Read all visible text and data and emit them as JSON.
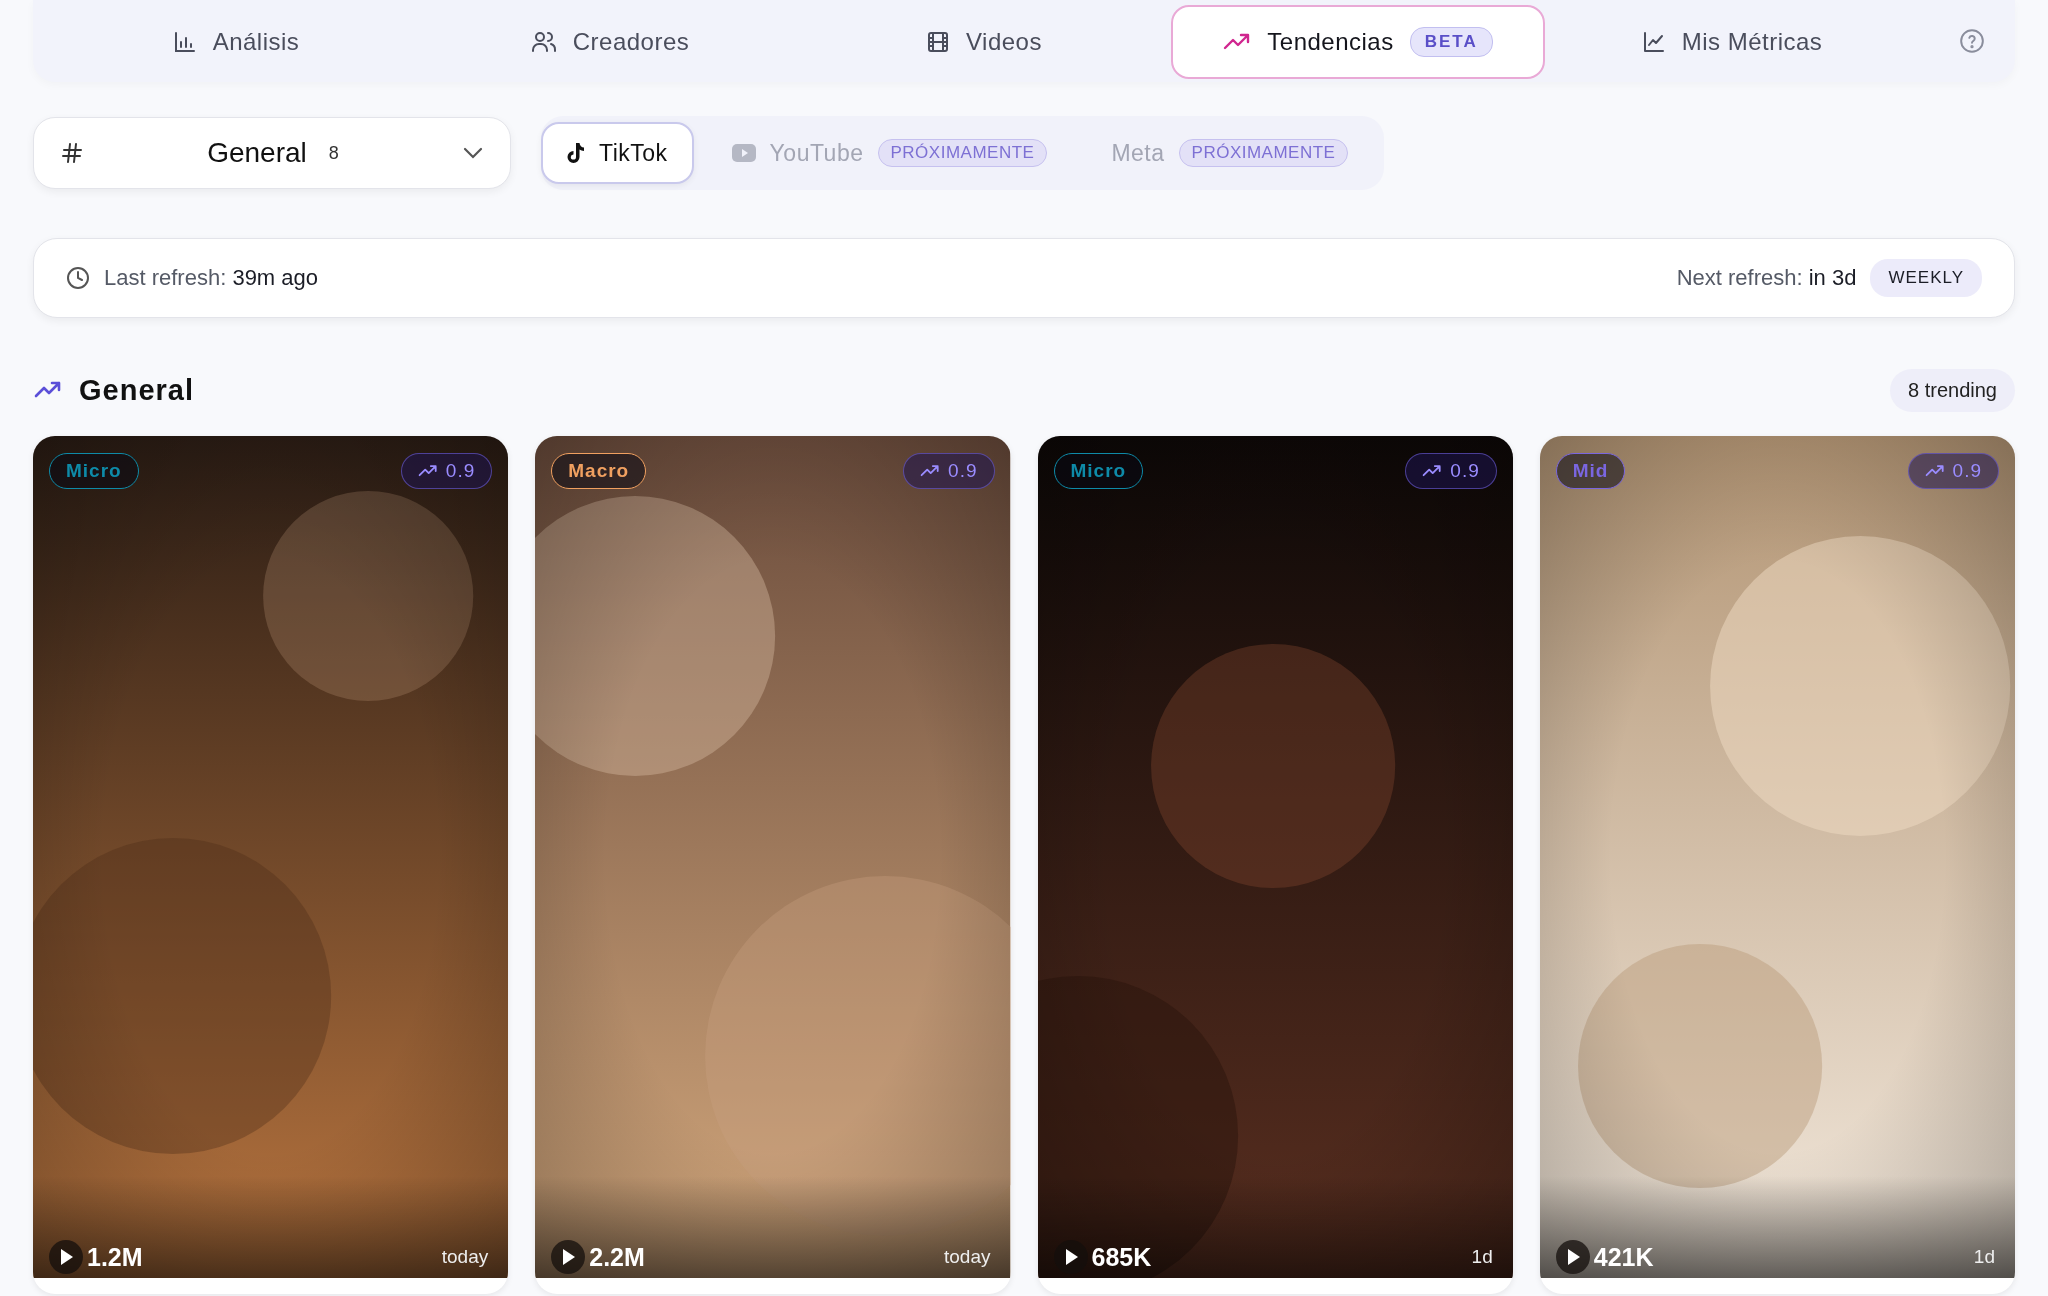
{
  "nav": {
    "tabs": [
      {
        "label": "Análisis",
        "selected": false
      },
      {
        "label": "Creadores",
        "selected": false
      },
      {
        "label": "Videos",
        "selected": false
      },
      {
        "label": "Tendencias",
        "selected": true,
        "badge": "BETA"
      },
      {
        "label": "Mis Métricas",
        "selected": false
      }
    ]
  },
  "category": {
    "value": "General",
    "count": "8"
  },
  "platforms": [
    {
      "label": "TikTok",
      "selected": true,
      "disabled": false
    },
    {
      "label": "YouTube",
      "selected": false,
      "disabled": true,
      "badge": "PRÓXIMAMENTE"
    },
    {
      "label": "Meta",
      "selected": false,
      "disabled": true,
      "badge": "PRÓXIMAMENTE"
    }
  ],
  "refresh": {
    "last_label": "Last refresh:",
    "last_value": "39m ago",
    "next_label": "Next refresh:",
    "next_value": "in 3d",
    "frequency": "WEEKLY"
  },
  "section": {
    "title": "General",
    "count": "8 trending"
  },
  "cards": [
    {
      "tier": "Micro",
      "color": "#0e8aa8",
      "score": "0.9",
      "views": "1.2M",
      "age": "today"
    },
    {
      "tier": "Macro",
      "color": "#f0a060",
      "score": "0.9",
      "views": "2.2M",
      "age": "today"
    },
    {
      "tier": "Micro",
      "color": "#0e8aa8",
      "score": "0.9",
      "views": "685K",
      "age": "1d"
    },
    {
      "tier": "Mid",
      "color": "#7a66e0",
      "score": "0.9",
      "views": "421K",
      "age": "1d"
    }
  ]
}
